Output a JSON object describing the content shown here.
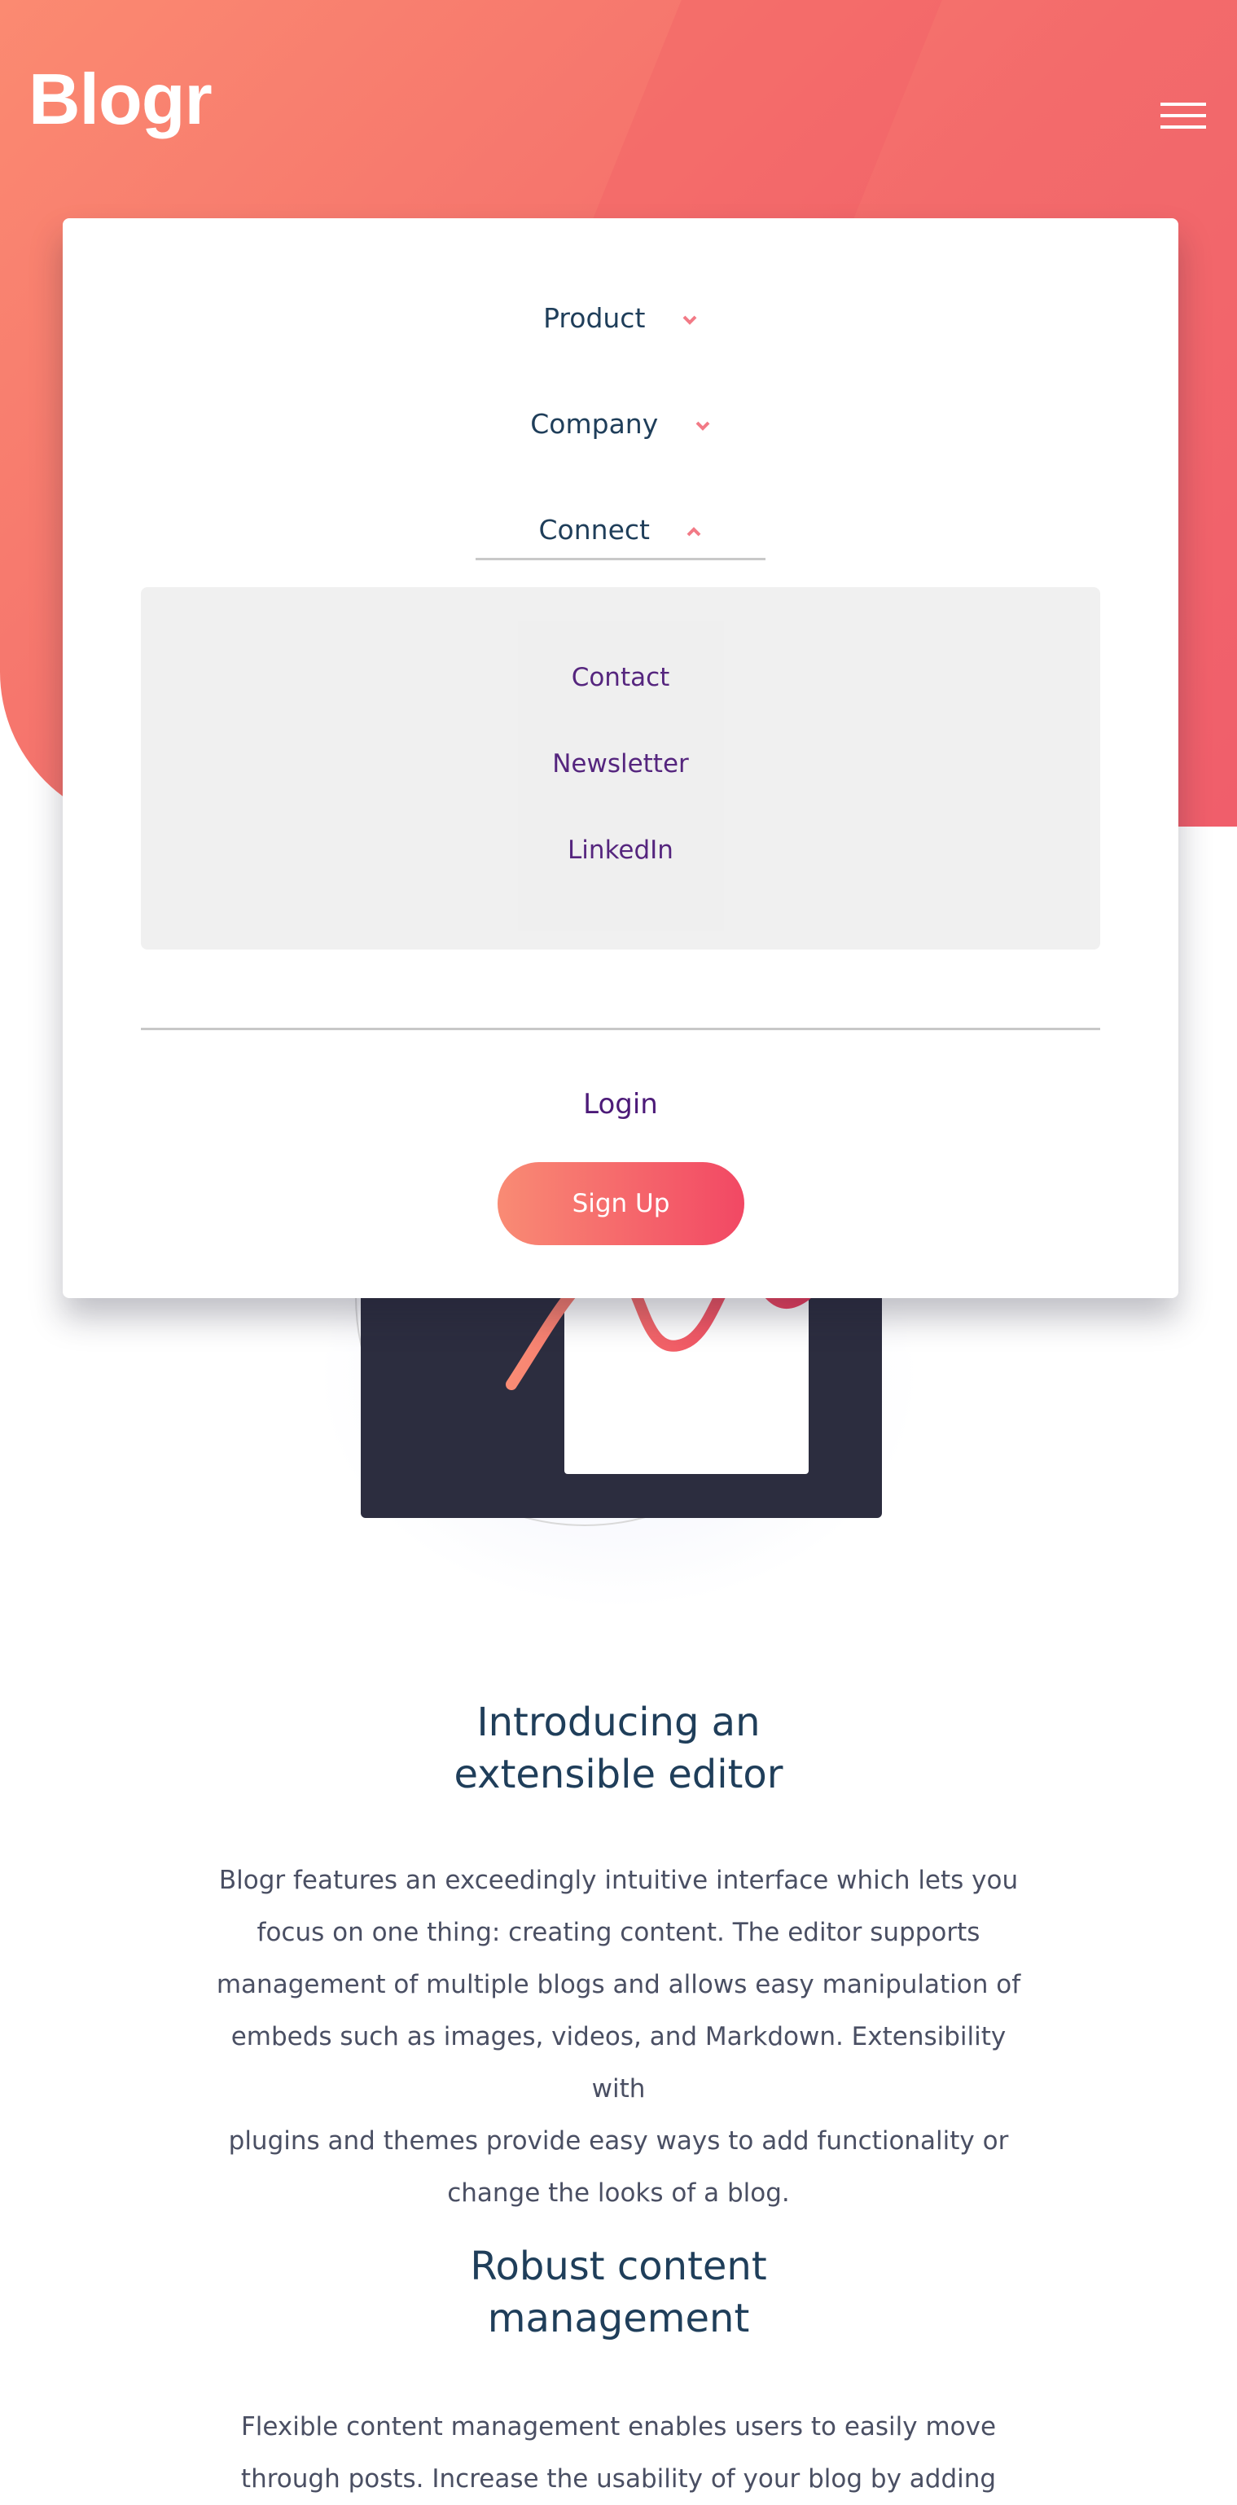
{
  "brand": {
    "logo": "Blogr"
  },
  "header": {
    "menu_icon": "hamburger-icon"
  },
  "menu": {
    "items": [
      {
        "label": "Product",
        "icon": "chevron-down-icon"
      },
      {
        "label": "Company",
        "icon": "chevron-down-icon"
      },
      {
        "label": "Connect",
        "icon": "chevron-up-icon"
      }
    ],
    "connect_links": [
      "Contact",
      "Newsletter",
      "LinkedIn"
    ],
    "login_label": "Login",
    "signup_label": "Sign Up"
  },
  "sections": [
    {
      "title_line1": "Introducing an",
      "title_line2": "extensible editor",
      "body": [
        "Blogr features an exceedingly intuitive interface which lets you",
        "focus on one thing: creating content. The editor supports",
        "management of multiple blogs and allows easy manipulation of",
        "embeds such as images, videos, and Markdown. Extensibility with",
        "plugins and themes provide easy ways to add functionality or",
        "change the looks of a blog."
      ]
    },
    {
      "title_line1": "Robust content",
      "title_line2": "management",
      "body": [
        "Flexible content management enables users to easily move",
        "through posts. Increase the usability of your blog by adding"
      ]
    }
  ],
  "colors": {
    "accent_gradient_start": "#f98b74",
    "accent_gradient_end": "#f24864",
    "link_purple": "#4c1a78",
    "heading_navy": "#1f3e5a"
  }
}
